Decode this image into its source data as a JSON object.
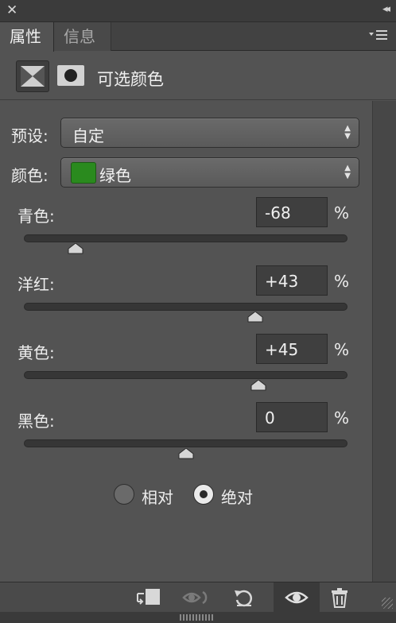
{
  "window": {
    "close_glyph": "✕",
    "collapse_glyph": "◂◂"
  },
  "tabs": [
    {
      "label": "属性",
      "active": true
    },
    {
      "label": "信息",
      "active": false
    }
  ],
  "panel": {
    "title": "可选颜色",
    "icon": "selective-color-icon",
    "mask_icon": "mask-icon"
  },
  "preset": {
    "label": "预设:",
    "value": "自定"
  },
  "colors": {
    "label": "颜色:",
    "value": "绿色",
    "swatch": "#2a8a1e"
  },
  "sliders": [
    {
      "label": "青色:",
      "value": "-68",
      "unit": "%",
      "position": 0.16
    },
    {
      "label": "洋红:",
      "value": "+43",
      "unit": "%",
      "position": 0.715
    },
    {
      "label": "黄色:",
      "value": "+45",
      "unit": "%",
      "position": 0.725
    },
    {
      "label": "黑色:",
      "value": "0",
      "unit": "%",
      "position": 0.5
    }
  ],
  "method": {
    "options": [
      {
        "label": "相对",
        "selected": false
      },
      {
        "label": "绝对",
        "selected": true
      }
    ]
  },
  "bottom_toolbar": {
    "buttons": [
      "clip-to-layer-icon",
      "view-previous-state-icon",
      "reset-icon",
      "visibility-eye-icon",
      "trash-icon"
    ]
  }
}
